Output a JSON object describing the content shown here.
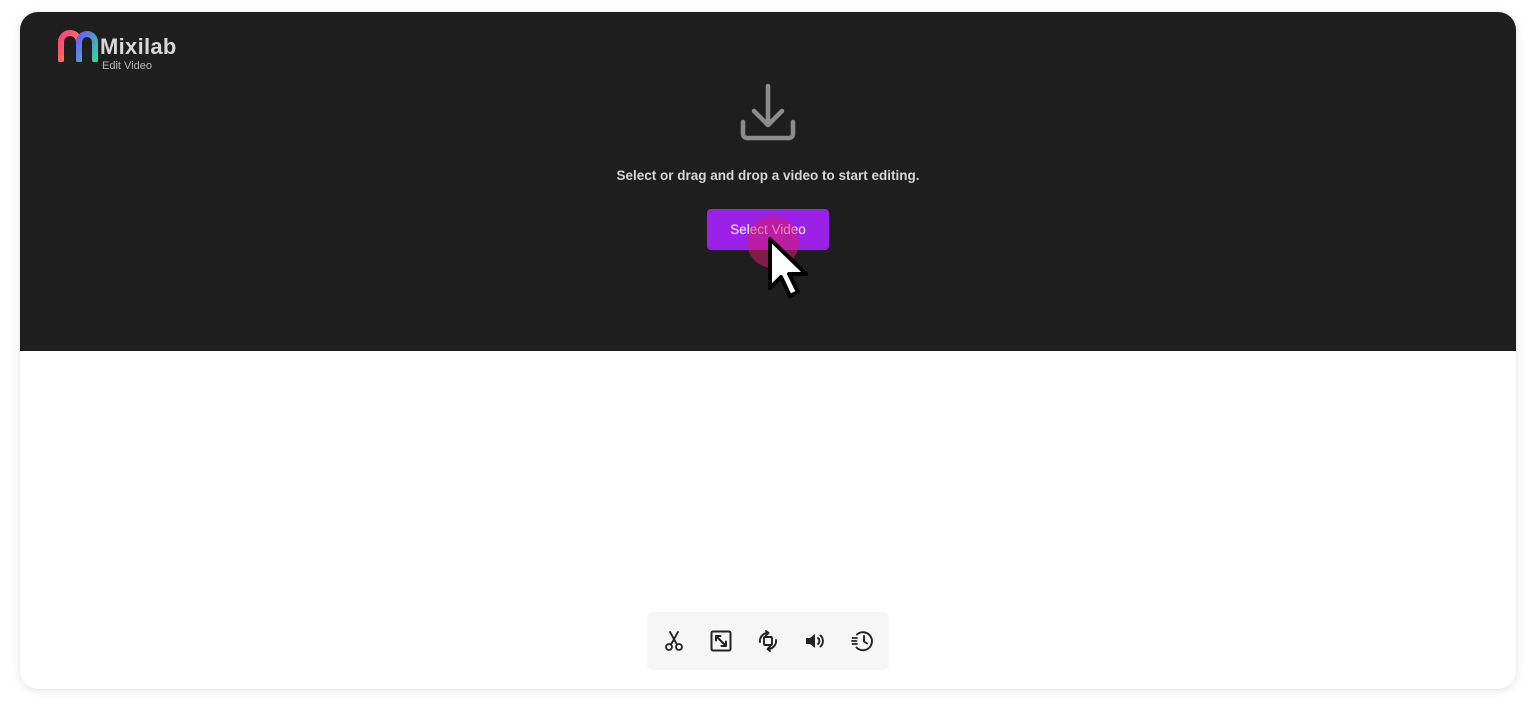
{
  "app": {
    "name": "Mixilab",
    "subtitle": "Edit Video"
  },
  "upload": {
    "icon": "download-tray-icon",
    "hint": "Select or drag and drop a video to start editing.",
    "button_label": "Select Video"
  },
  "toolbar": {
    "tools": [
      {
        "name": "cut",
        "icon": "scissors-icon"
      },
      {
        "name": "resize",
        "icon": "resize-icon"
      },
      {
        "name": "rotate",
        "icon": "rotate-icon"
      },
      {
        "name": "volume",
        "icon": "volume-icon"
      },
      {
        "name": "history",
        "icon": "history-icon"
      }
    ]
  },
  "colors": {
    "drop_zone_bg": "#1e1e1e",
    "accent": "#9b21e8",
    "logo_gradient": [
      "#ff3d7f",
      "#ff9a3c",
      "#6b5bff",
      "#35d0a0"
    ]
  }
}
